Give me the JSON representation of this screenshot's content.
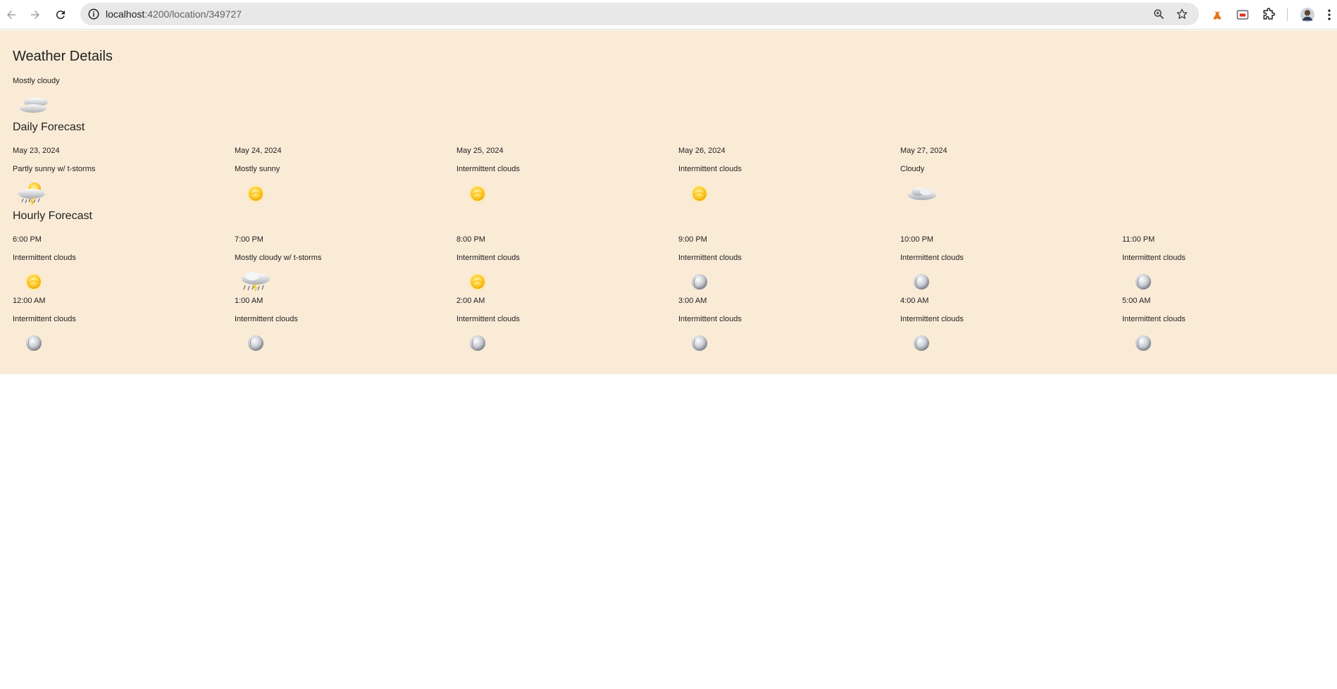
{
  "browser": {
    "url_host": "localhost",
    "url_path": ":4200/location/349727"
  },
  "page": {
    "title": "Weather Details",
    "current": {
      "condition": "Mostly cloudy",
      "icon": "mostly-cloudy-icon"
    },
    "daily_title": "Daily Forecast",
    "daily": [
      {
        "date": "May 23, 2024",
        "condition": "Partly sunny w/ t-storms",
        "icon": "sun-cloud-storm-icon"
      },
      {
        "date": "May 24, 2024",
        "condition": "Mostly sunny",
        "icon": "sun-icon"
      },
      {
        "date": "May 25, 2024",
        "condition": "Intermittent clouds",
        "icon": "sun-icon"
      },
      {
        "date": "May 26, 2024",
        "condition": "Intermittent clouds",
        "icon": "sun-icon"
      },
      {
        "date": "May 27, 2024",
        "condition": "Cloudy",
        "icon": "cloud-icon"
      }
    ],
    "hourly_title": "Hourly Forecast",
    "hourly": [
      {
        "time": "6:00 PM",
        "condition": "Intermittent clouds",
        "icon": "sun-icon"
      },
      {
        "time": "7:00 PM",
        "condition": "Mostly cloudy w/ t-storms",
        "icon": "cloud-storm-icon"
      },
      {
        "time": "8:00 PM",
        "condition": "Intermittent clouds",
        "icon": "sun-icon"
      },
      {
        "time": "9:00 PM",
        "condition": "Intermittent clouds",
        "icon": "moon-icon"
      },
      {
        "time": "10:00 PM",
        "condition": "Intermittent clouds",
        "icon": "moon-icon"
      },
      {
        "time": "11:00 PM",
        "condition": "Intermittent clouds",
        "icon": "moon-icon"
      },
      {
        "time": "12:00 AM",
        "condition": "Intermittent clouds",
        "icon": "moon-icon"
      },
      {
        "time": "1:00 AM",
        "condition": "Intermittent clouds",
        "icon": "moon-icon"
      },
      {
        "time": "2:00 AM",
        "condition": "Intermittent clouds",
        "icon": "moon-icon"
      },
      {
        "time": "3:00 AM",
        "condition": "Intermittent clouds",
        "icon": "moon-icon"
      },
      {
        "time": "4:00 AM",
        "condition": "Intermittent clouds",
        "icon": "moon-icon"
      },
      {
        "time": "5:00 AM",
        "condition": "Intermittent clouds",
        "icon": "moon-icon"
      }
    ]
  },
  "colors": {
    "page_background": "#faebd7",
    "omnibox": "#e8e8e8"
  }
}
